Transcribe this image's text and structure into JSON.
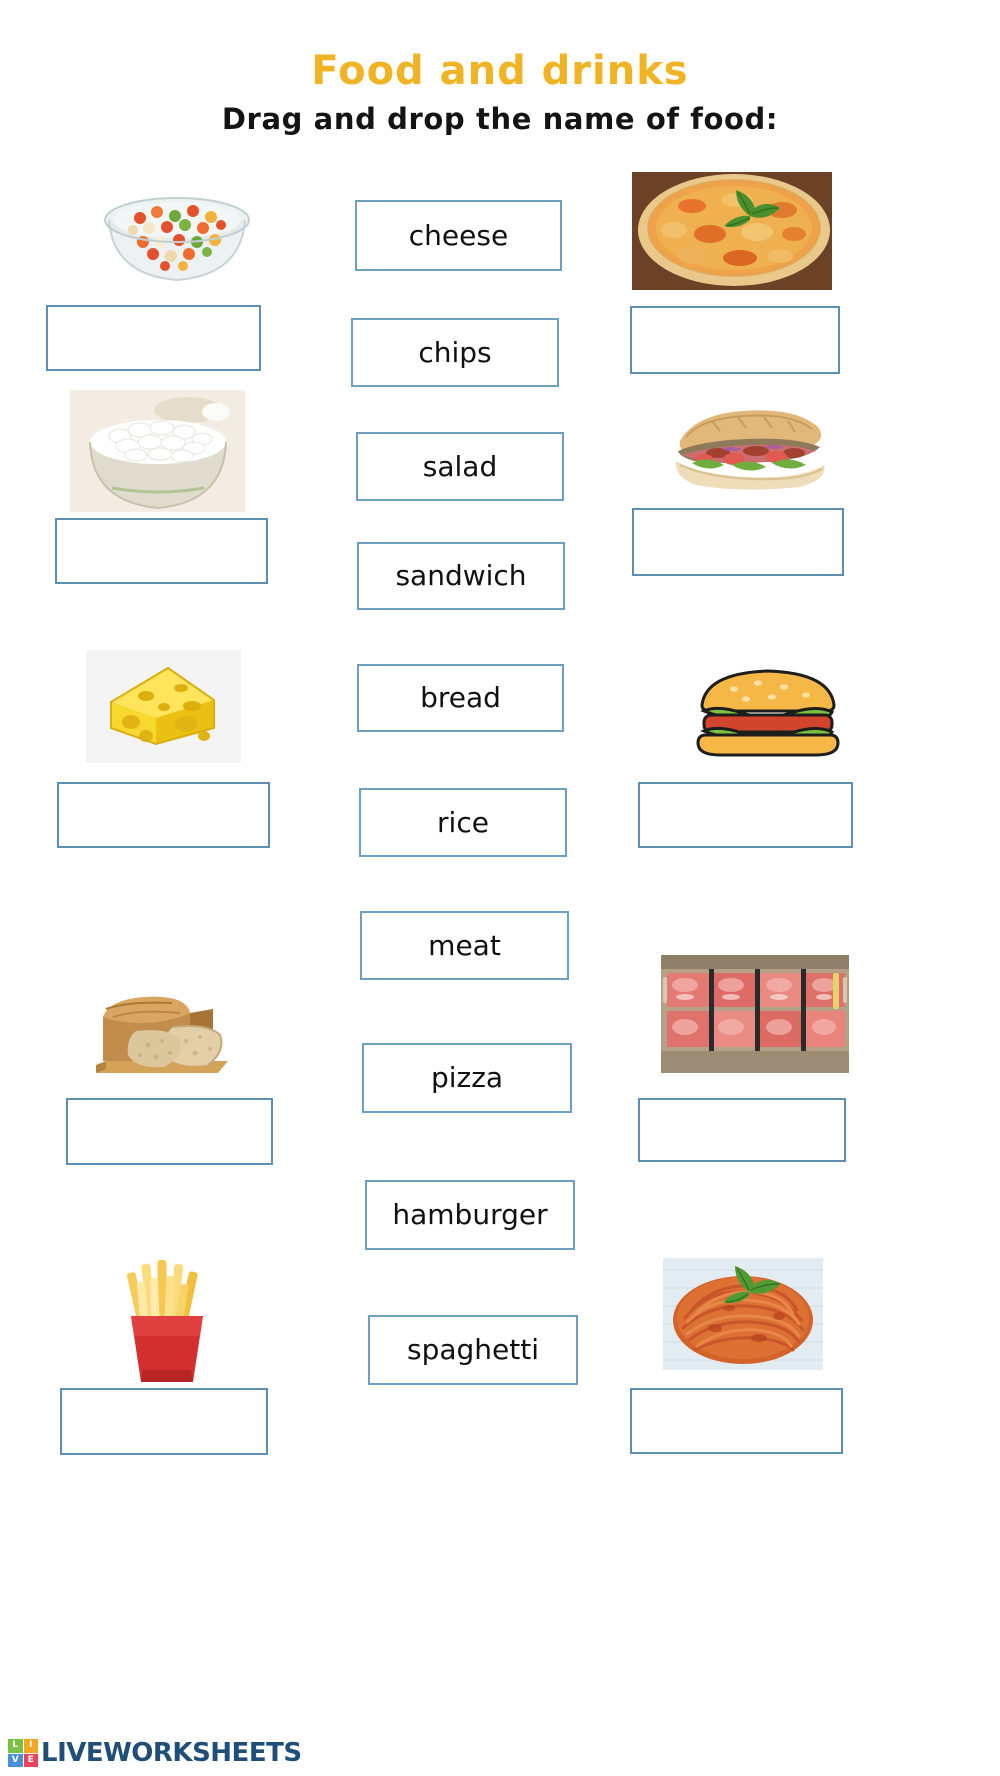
{
  "header": {
    "title": "Food and drinks",
    "instruction": "Drag and drop the name of food:",
    "title_color": "#f0b323",
    "instruction_color": "#141414"
  },
  "colors": {
    "box_border": "#5b8fb4",
    "word_box_border": "#6f9fc0",
    "page_background": "#ffffff",
    "logo_text": "#1f4e79"
  },
  "word_bank": {
    "items": [
      {
        "label": "cheese"
      },
      {
        "label": "chips"
      },
      {
        "label": "salad"
      },
      {
        "label": "sandwich"
      },
      {
        "label": "bread"
      },
      {
        "label": "rice"
      },
      {
        "label": "meat"
      },
      {
        "label": "pizza"
      },
      {
        "label": "hamburger"
      },
      {
        "label": "spaghetti"
      }
    ]
  },
  "left_column": {
    "items": [
      {
        "image": "salad-bowl-image",
        "answer": ""
      },
      {
        "image": "rice-bowl-image",
        "answer": ""
      },
      {
        "image": "cheese-wedge-image",
        "answer": ""
      },
      {
        "image": "bread-loaf-image",
        "answer": ""
      },
      {
        "image": "french-fries-image",
        "answer": ""
      }
    ]
  },
  "right_column": {
    "items": [
      {
        "image": "pizza-image",
        "answer": ""
      },
      {
        "image": "sub-sandwich-image",
        "answer": ""
      },
      {
        "image": "hamburger-image",
        "answer": ""
      },
      {
        "image": "meat-counter-image",
        "answer": ""
      },
      {
        "image": "spaghetti-image",
        "answer": ""
      }
    ]
  },
  "footer": {
    "logo_letters": [
      "L",
      "I",
      "V",
      "E"
    ],
    "wordmark": "LIVEWORKSHEETS"
  }
}
